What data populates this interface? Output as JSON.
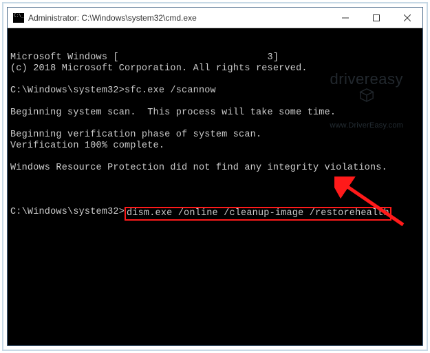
{
  "window": {
    "title": "Administrator: C:\\Windows\\system32\\cmd.exe"
  },
  "watermark": {
    "brand_a": "driver",
    "brand_b": "easy",
    "url": "www.DriverEasy.com"
  },
  "console": {
    "lines": [
      "Microsoft Windows [                          3]",
      "(c) 2018 Microsoft Corporation. All rights reserved.",
      "",
      "C:\\Windows\\system32>sfc.exe /scannow",
      "",
      "Beginning system scan.  This process will take some time.",
      "",
      "Beginning verification phase of system scan.",
      "Verification 100% complete.",
      "",
      "Windows Resource Protection did not find any integrity violations.",
      ""
    ],
    "final_prompt": "C:\\Windows\\system32>",
    "highlighted_command": "dism.exe /online /cleanup-image /restorehealth"
  }
}
